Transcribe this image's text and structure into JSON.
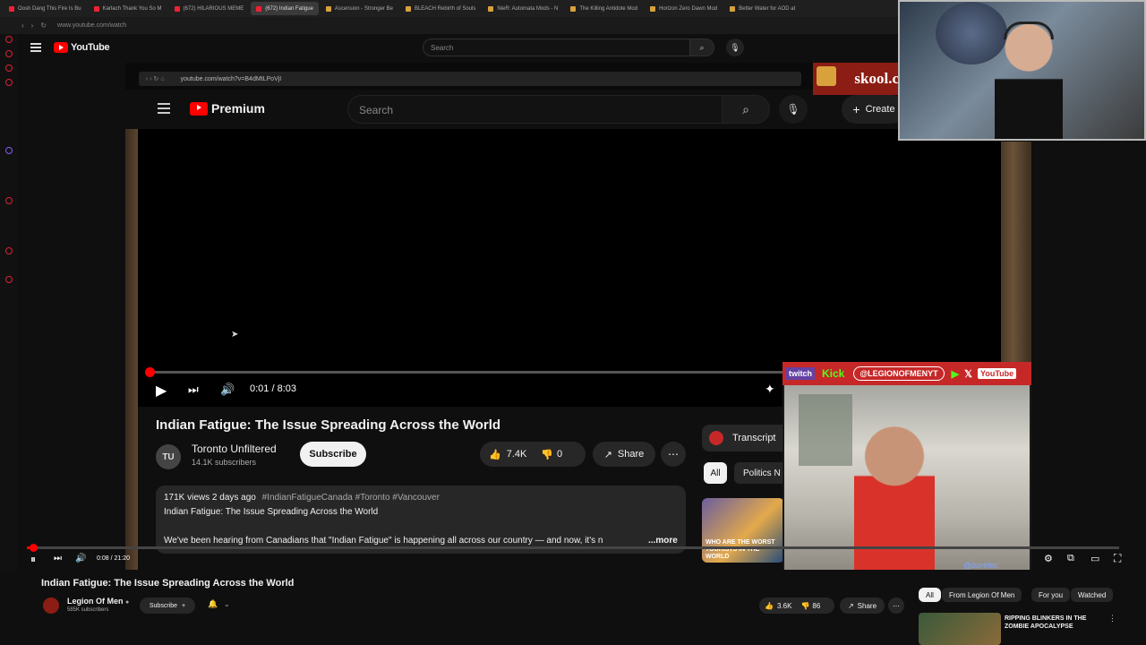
{
  "browser": {
    "tabs": [
      {
        "label": "Oosh Dang This Fire Is Bu",
        "type": "yt"
      },
      {
        "label": "Karlach Thank You So M",
        "type": "yt"
      },
      {
        "label": "(672) HILARIOUS MEME",
        "type": "yt"
      },
      {
        "label": "(672) Indian Fatigue",
        "type": "yt",
        "active": true
      },
      {
        "label": "Ascension - Stronger Be",
        "type": "folder"
      },
      {
        "label": "BLEACH Rebirth of Souls",
        "type": "folder"
      },
      {
        "label": "NieR: Automata Mods - N",
        "type": "folder"
      },
      {
        "label": "The Killing Antidote Mod",
        "type": "folder"
      },
      {
        "label": "Horizon Zero Dawn Mod",
        "type": "folder"
      },
      {
        "label": "Better Water for AOD at",
        "type": "folder"
      }
    ],
    "url": "www.youtube.com/watch"
  },
  "outer_youtube": {
    "logo_text": "YouTube",
    "search_placeholder": "Search",
    "video_title": "Indian Fatigue: The Issue Spreading Across the World",
    "channel_name": "Legion Of Men",
    "channel_subs": "585K subscribers",
    "subscribe_label": "Subscribe",
    "likes": "3.6K",
    "dislikes": "86",
    "share_label": "Share",
    "time": "0:08 / 21:20",
    "progress_fraction": 0.006,
    "chips": [
      "All",
      "From Legion Of Men",
      "For you",
      "Watched"
    ],
    "rec_title": "RIPPING BLINKERS IN THE ZOMBIE APOCALYPSE"
  },
  "inner_youtube": {
    "url": "youtube.com/watch?v=B4dMtLPoVjI",
    "logo_text": "Premium",
    "search_placeholder": "Search",
    "create_label": "Create",
    "time": "0:01 / 8:03",
    "progress_fraction": 0.002,
    "video_title": "Indian Fatigue: The Issue Spreading Across the World",
    "channel_name": "Toronto Unfiltered",
    "channel_subs": "14.1K subscribers",
    "channel_avatar_text": "TU",
    "subscribe_label": "Subscribe",
    "likes": "7.4K",
    "dislikes": "0",
    "share_label": "Share",
    "transcript_label": "Transcript",
    "chips": [
      "All",
      "Politics N"
    ],
    "desc_stats": "171K views  2 days ago",
    "desc_tags": "#IndianFatigueCanada #Toronto #Vancouver",
    "desc_line1": "Indian Fatigue: The Issue Spreading Across the World",
    "desc_line2": "We've been hearing from Canadians that \"Indian Fatigue\" is happening all across our country — and now, it's n",
    "desc_more": "...more",
    "thumb_text": "WHO ARE THE WORST TOURISTS IN THE WORLD"
  },
  "overlays": {
    "sponsor_text": "skool.c",
    "guest_bar_handle": "@LEGIONOFMENYT",
    "guest_bar_twitch": "twitch",
    "guest_bar_kick": "Kick",
    "guest_bar_yt": "YouTube",
    "guest_handle_bottom": "@borefec"
  },
  "colors": {
    "yt_red": "#ff0000",
    "bg": "#0f0f0f",
    "chip_bg": "#272727",
    "overlay_red": "#c62828",
    "kick_green": "#53fc18"
  }
}
